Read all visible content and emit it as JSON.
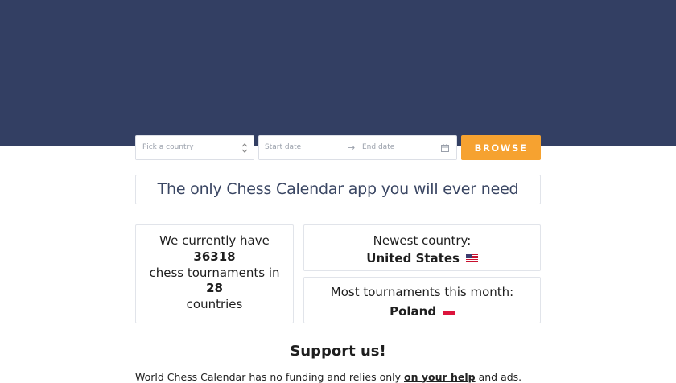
{
  "search": {
    "country_placeholder": "Pick a country",
    "start_placeholder": "Start date",
    "range_separator": "→",
    "end_placeholder": "End date",
    "browse_label": "BROWSE"
  },
  "tagline": "The only Chess Calendar app you will ever need",
  "stats": {
    "line1": "We currently have",
    "tournaments": "36318",
    "line2": "chess tournaments in",
    "countries": "28",
    "line3": "countries"
  },
  "newest": {
    "label": "Newest country:",
    "country": "United States"
  },
  "most": {
    "label": "Most tournaments this month:",
    "country": "Poland"
  },
  "support": {
    "title": "Support us!",
    "text_start": "World Chess Calendar has no funding and relies only ",
    "text_link": "on your help",
    "text_end": " and ads."
  },
  "colors": {
    "hero_bg": "#333f63",
    "accent": "#f6a230"
  }
}
